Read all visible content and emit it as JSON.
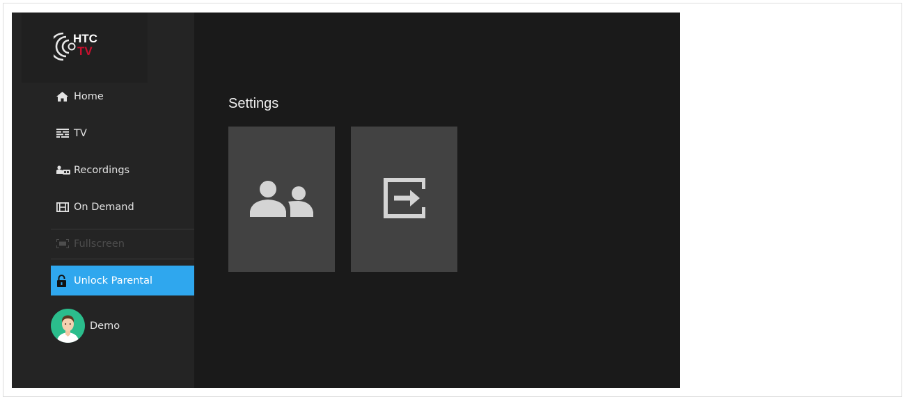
{
  "logo": {
    "line1": "HTC",
    "line2": "TV"
  },
  "sidebar": {
    "items": [
      {
        "label": "Home",
        "icon": "home-icon"
      },
      {
        "label": "TV",
        "icon": "guide-icon"
      },
      {
        "label": "Recordings",
        "icon": "recordings-icon"
      },
      {
        "label": "On Demand",
        "icon": "film-icon"
      },
      {
        "label": "Fullscreen",
        "icon": "fullscreen-icon",
        "disabled": true
      },
      {
        "label": "Unlock Parental",
        "icon": "lock-icon",
        "active": true
      }
    ],
    "user": {
      "name": "Demo"
    }
  },
  "main": {
    "title": "Settings",
    "tiles": [
      {
        "icon": "users-icon"
      },
      {
        "icon": "logout-icon"
      }
    ]
  },
  "colors": {
    "accent": "#2fa7ee",
    "sidebar_bg": "#242424",
    "main_bg": "#1a1a1a",
    "tile_bg": "#424242",
    "logo_red": "#c8102e",
    "avatar_bg": "#2bbd8c"
  }
}
